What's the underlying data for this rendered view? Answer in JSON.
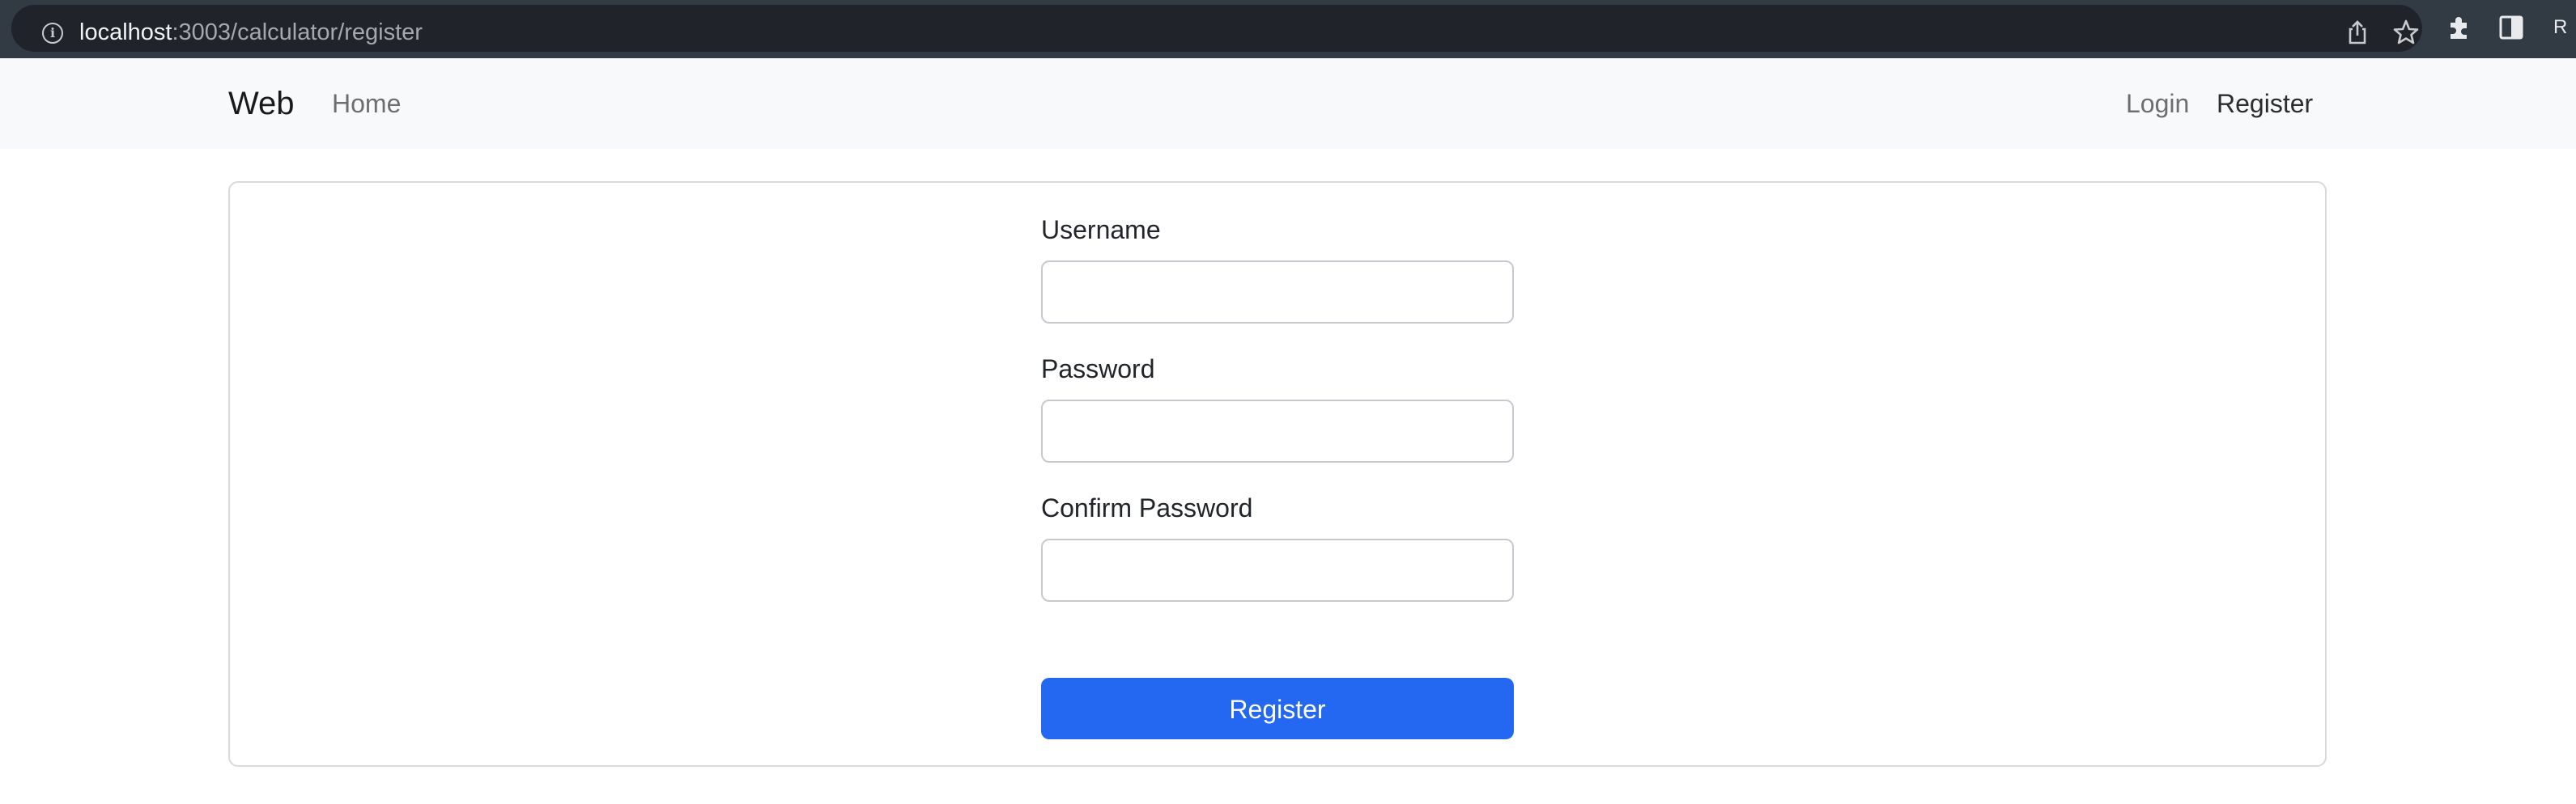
{
  "browser": {
    "url_host": "localhost",
    "url_path": ":3003/calculator/register",
    "profile_initial": "R",
    "icons": [
      "info-icon",
      "share-icon",
      "star-icon",
      "extensions-puzzle-icon",
      "side-panel-icon"
    ]
  },
  "navbar": {
    "brand": "Web",
    "links": {
      "home": "Home",
      "login": "Login",
      "register": "Register"
    }
  },
  "form": {
    "username_label": "Username",
    "username_value": "",
    "password_label": "Password",
    "password_value": "",
    "confirm_label": "Confirm Password",
    "confirm_value": "",
    "submit_label": "Register"
  },
  "colors": {
    "chrome": "#323a44",
    "navbar_bg": "#f8f9fa",
    "primary": "#2468f2"
  }
}
